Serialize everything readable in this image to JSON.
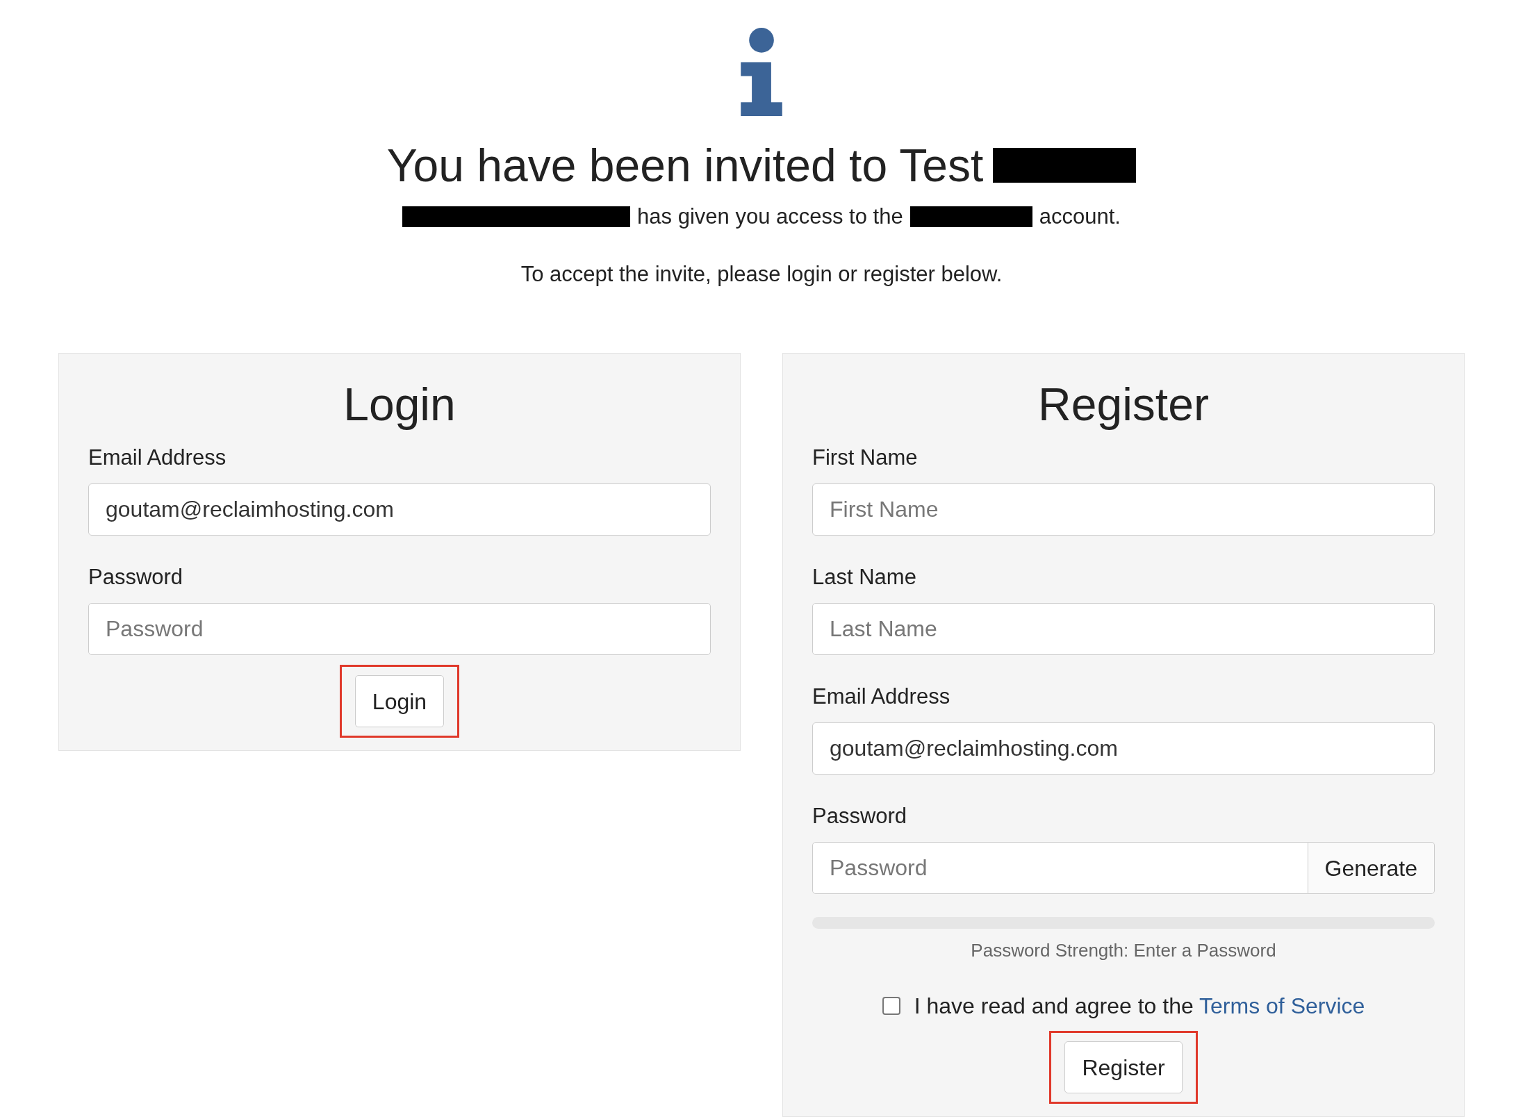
{
  "header": {
    "title": "You have been invited to Test",
    "message_parts": [
      "has given you access to the",
      "account."
    ],
    "instructions": "To accept the invite, please login or register below."
  },
  "login": {
    "title": "Login",
    "fields": [
      {
        "label": "Email Address",
        "value": "goutam@reclaimhosting.com"
      },
      {
        "label": "Password",
        "placeholder": "Password"
      }
    ],
    "button": "Login"
  },
  "register": {
    "title": "Register",
    "fields": [
      {
        "label": "First Name",
        "placeholder": "First Name"
      },
      {
        "label": "Last Name",
        "placeholder": "Last Name"
      },
      {
        "label": "Email Address",
        "value": "goutam@reclaimhosting.com"
      },
      {
        "label": "Password",
        "placeholder": "Password",
        "addon": "Generate"
      }
    ],
    "strength": {
      "level": 0,
      "text": "Password Strength: Enter a Password"
    },
    "terms": {
      "checked": false,
      "text": "I have read and agree to the",
      "link": "Terms of Service"
    },
    "button": "Register"
  }
}
